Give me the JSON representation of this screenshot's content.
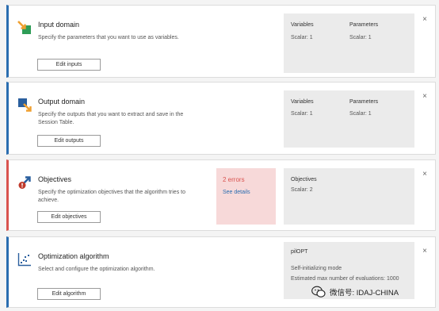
{
  "cards": {
    "input": {
      "title": "Input domain",
      "description": "Specify the parameters that you want to use as variables.",
      "button": "Edit inputs",
      "panel": {
        "col1_header": "Variables",
        "col1_value": "Scalar: 1",
        "col2_header": "Parameters",
        "col2_value": "Scalar: 1"
      },
      "close": "×"
    },
    "output": {
      "title": "Output domain",
      "description": "Specify the outputs that you want to extract and save in the Session Table.",
      "button": "Edit outputs",
      "panel": {
        "col1_header": "Variables",
        "col1_value": "Scalar: 1",
        "col2_header": "Parameters",
        "col2_value": "Scalar: 1"
      },
      "close": "×"
    },
    "objectives": {
      "title": "Objectives",
      "description": "Specify the optimization objectives that the algorithm tries to achieve.",
      "button": "Edit objectives",
      "errors": {
        "count": "2 errors",
        "link": "See details"
      },
      "panel": {
        "header": "Objectives",
        "value": "Scalar: 2"
      },
      "close": "×"
    },
    "algorithm": {
      "title": "Optimization algorithm",
      "description": "Select and configure the optimization algorithm.",
      "button": "Edit algorithm",
      "panel": {
        "name": "pilOPT",
        "line1": "Self-initializing mode",
        "line2": "Estimated max number of evaluations: 1000"
      },
      "close": "×"
    }
  },
  "watermark": {
    "text": "微信号: IDAJ-CHINA"
  },
  "colors": {
    "accent": "#2a6db0",
    "error": "#d9534f",
    "icon_green": "#2e9d57",
    "icon_orange": "#f0a030"
  }
}
